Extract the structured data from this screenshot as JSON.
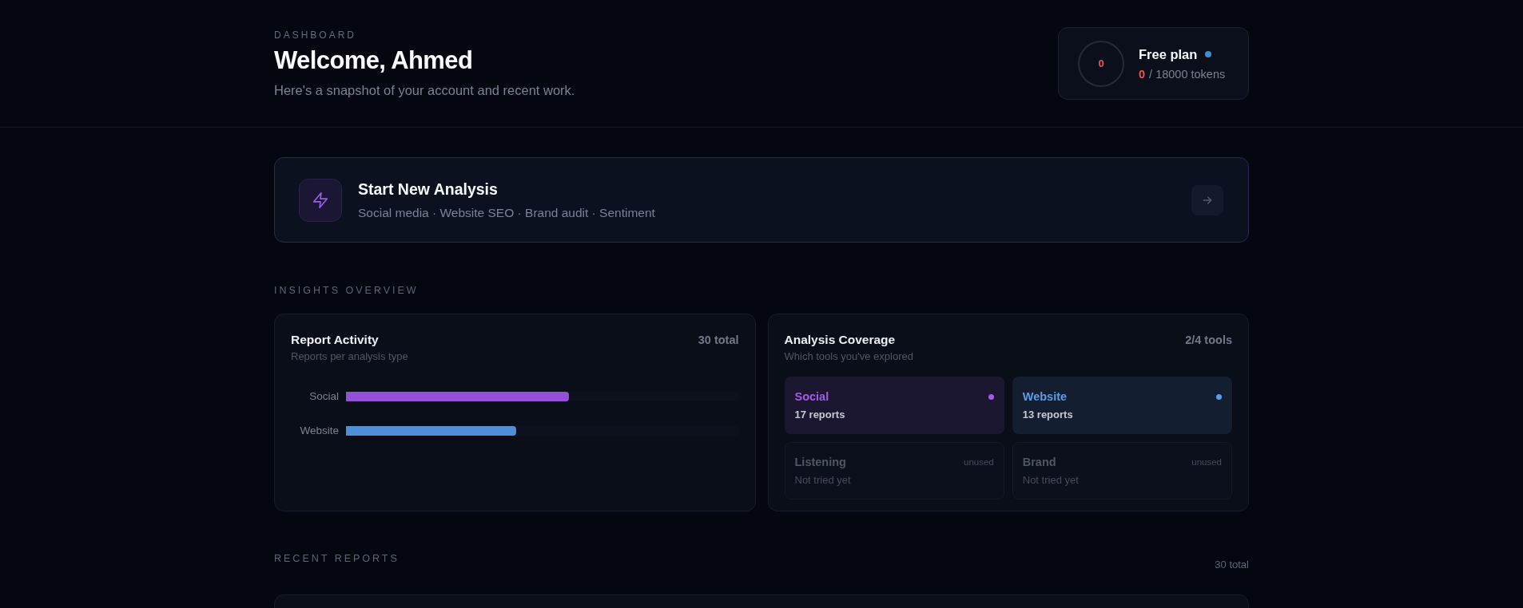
{
  "header": {
    "eyebrow": "DASHBOARD",
    "title": "Welcome, Ahmed",
    "subtitle": "Here's a snapshot of your account and recent work."
  },
  "plan": {
    "ring_value": "0",
    "name": "Free plan",
    "used": "0",
    "quota": "/ 18000 tokens"
  },
  "start_card": {
    "title": "Start New Analysis",
    "subtitle": "Social media · Website SEO · Brand audit · Sentiment"
  },
  "insights": {
    "heading": "INSIGHTS OVERVIEW"
  },
  "report_activity": {
    "title": "Report Activity",
    "total": "30 total",
    "subtitle": "Reports per analysis type",
    "bars": [
      {
        "label": "Social",
        "level": 0.567,
        "color": "#9550d8"
      },
      {
        "label": "Website",
        "level": 0.433,
        "color": "#4f8ed9"
      }
    ]
  },
  "coverage": {
    "title": "Analysis Coverage",
    "count": "2/4 tools",
    "subtitle": "Which tools you've explored",
    "tools": [
      {
        "name": "Social",
        "detail": "17 reports",
        "used": true,
        "color": "#a35be8"
      },
      {
        "name": "Website",
        "detail": "13 reports",
        "used": true,
        "color": "#5a9ee8"
      },
      {
        "name": "Listening",
        "detail": "Not tried yet",
        "used": false,
        "tag": "unused"
      },
      {
        "name": "Brand",
        "detail": "Not tried yet",
        "used": false,
        "tag": "unused"
      }
    ]
  },
  "recent_reports": {
    "heading": "RECENT REPORTS",
    "total": "30 total"
  }
}
